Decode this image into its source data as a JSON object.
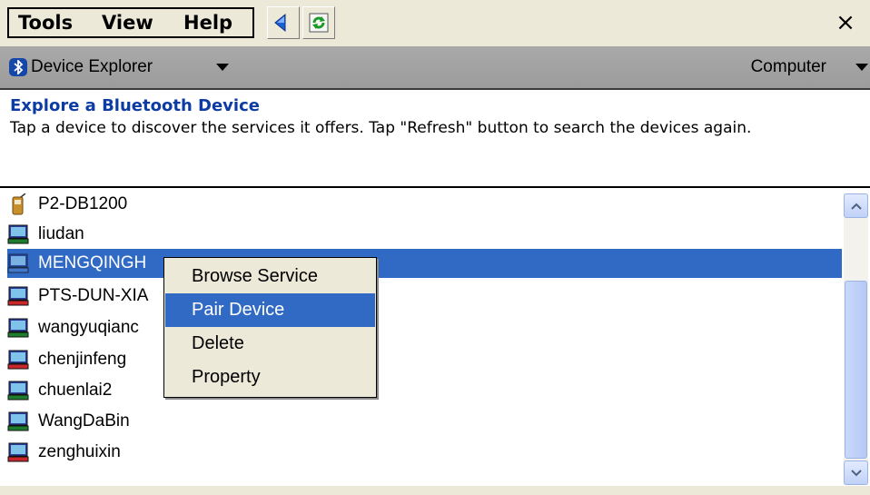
{
  "menubar": {
    "items": [
      "Tools",
      "View",
      "Help"
    ],
    "back_icon": "back-arrow-icon",
    "refresh_icon": "refresh-icon",
    "close_label": "×"
  },
  "navbar": {
    "title": "Device Explorer",
    "right_label": "Computer",
    "icon": "bluetooth-icon"
  },
  "page": {
    "title": "Explore a Bluetooth Device",
    "description": "Tap a device to discover the services it offers. Tap \"Refresh\" button to search the devices again."
  },
  "devices": [
    {
      "name": "P2-DB1200",
      "icon": "phone-icon"
    },
    {
      "name": "liudan",
      "icon": "computer-icon"
    },
    {
      "name": "MENGQINGHUA",
      "icon": "computer-icon",
      "selected": true,
      "visible_name": "MENGQINGH"
    },
    {
      "name": "PTS-DUN-XIA",
      "icon": "computer-icon",
      "visible_name": "PTS-DUN-XIA"
    },
    {
      "name": "wangyuqiang",
      "icon": "computer-icon",
      "visible_name": "wangyuqianc"
    },
    {
      "name": "chenjinfeng",
      "icon": "computer-icon"
    },
    {
      "name": "chuenlai2",
      "icon": "computer-icon"
    },
    {
      "name": "WangDaBin",
      "icon": "computer-icon"
    },
    {
      "name": "zenghuixin",
      "icon": "computer-icon"
    }
  ],
  "context_menu": {
    "items": [
      "Browse Service",
      "Pair Device",
      "Delete",
      "Property"
    ],
    "highlighted": "Pair Device"
  },
  "colors": {
    "selection": "#316ac5",
    "title_blue": "#0c3ca3",
    "chrome": "#ece9d8"
  }
}
